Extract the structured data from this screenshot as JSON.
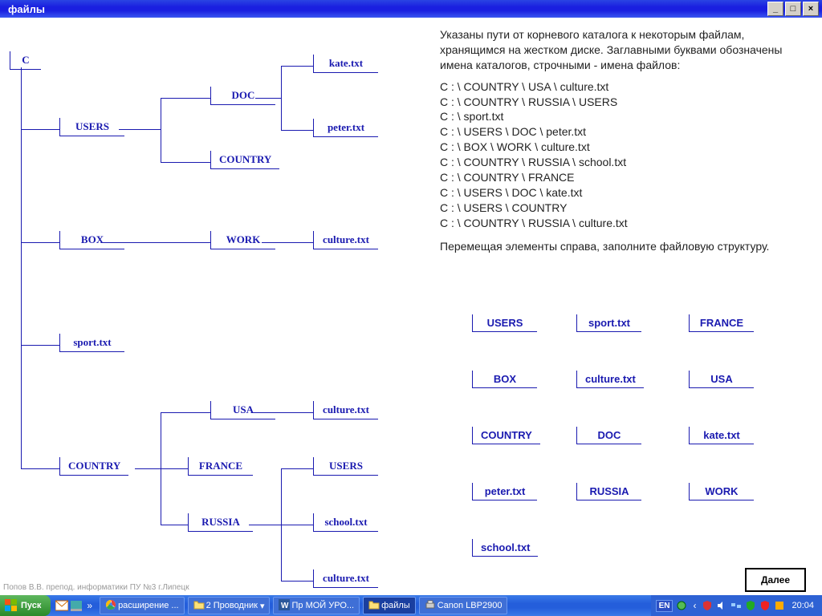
{
  "window": {
    "title": "файлы"
  },
  "winbuttons": {
    "min": "_",
    "max": "□",
    "close": "×"
  },
  "root": "C",
  "tree": {
    "users": "USERS",
    "doc": "DOC",
    "country1": "COUNTRY",
    "kate": "kate.txt",
    "peter": "peter.txt",
    "box": "BOX",
    "work": "WORK",
    "culture1": "culture.txt",
    "sport": "sport.txt",
    "country2": "COUNTRY",
    "usa": "USA",
    "france": "FRANCE",
    "russia": "RUSSIA",
    "culture2": "culture.txt",
    "users2": "USERS",
    "school": "school.txt",
    "culture3": "culture.txt"
  },
  "description": "Указаны пути от корневого каталога к некоторым файлам, хранящимся на жестком диске. Заглавными буквами обозначены имена каталогов, строчными - имена файлов:",
  "paths": [
    "C : \\ COUNTRY \\ USA \\ culture.txt",
    "C : \\ COUNTRY \\ RUSSIA \\ USERS",
    "C : \\ sport.txt",
    "C : \\ USERS \\ DOC \\ peter.txt",
    "C : \\ BOX \\ WORK \\ culture.txt",
    "C : \\ COUNTRY \\ RUSSIA \\ school.txt",
    "C : \\ COUNTRY \\ FRANCE",
    "C : \\ USERS \\ DOC \\ kate.txt",
    "C : \\ USERS \\ COUNTRY",
    "C : \\ COUNTRY \\ RUSSIA \\ culture.txt"
  ],
  "instruction": "Перемещая элементы справа, заполните файловую структуру.",
  "palette": [
    "USERS",
    "sport.txt",
    "FRANCE",
    "BOX",
    "culture.txt",
    "USA",
    "COUNTRY",
    "DOC",
    "kate.txt",
    "peter.txt",
    "RUSSIA",
    "WORK",
    "school.txt"
  ],
  "next_button": "Далее",
  "footnote": "Попов В.В. препод. информатики ПУ №3 г.Липецк",
  "taskbar": {
    "start": "Пуск",
    "items": [
      {
        "label": "расширение ...",
        "active": false,
        "icon": "chrome"
      },
      {
        "label": "2 Проводник",
        "active": false,
        "icon": "folder",
        "arrow": true
      },
      {
        "label": "Пр МОЙ УРО...",
        "active": false,
        "icon": "word"
      },
      {
        "label": "файлы",
        "active": true,
        "icon": "folder-open"
      },
      {
        "label": "Canon LBP2900",
        "active": false,
        "icon": "printer"
      }
    ],
    "lang": "EN",
    "clock": "20:04"
  }
}
